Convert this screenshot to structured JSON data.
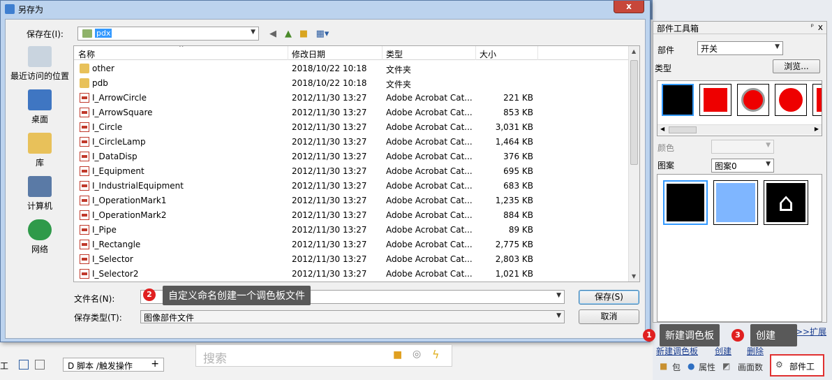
{
  "dialog": {
    "title": "另存为",
    "save_in_label": "保存在(I):",
    "save_in_value": "pdx",
    "places": [
      "最近访问的位置",
      "桌面",
      "库",
      "计算机",
      "网络"
    ],
    "columns": [
      "名称",
      "修改日期",
      "类型",
      "大小"
    ],
    "files": [
      {
        "name": "other",
        "date": "2018/10/22 10:18",
        "type": "文件夹",
        "size": "",
        "kind": "folder"
      },
      {
        "name": "pdb",
        "date": "2018/10/22 10:18",
        "type": "文件夹",
        "size": "",
        "kind": "folder"
      },
      {
        "name": "I_ArrowCircle",
        "date": "2012/11/30 13:27",
        "type": "Adobe Acrobat Cat...",
        "size": "221 KB",
        "kind": "pdf"
      },
      {
        "name": "I_ArrowSquare",
        "date": "2012/11/30 13:27",
        "type": "Adobe Acrobat Cat...",
        "size": "853 KB",
        "kind": "pdf"
      },
      {
        "name": "I_Circle",
        "date": "2012/11/30 13:27",
        "type": "Adobe Acrobat Cat...",
        "size": "3,031 KB",
        "kind": "pdf"
      },
      {
        "name": "I_CircleLamp",
        "date": "2012/11/30 13:27",
        "type": "Adobe Acrobat Cat...",
        "size": "1,464 KB",
        "kind": "pdf"
      },
      {
        "name": "I_DataDisp",
        "date": "2012/11/30 13:27",
        "type": "Adobe Acrobat Cat...",
        "size": "376 KB",
        "kind": "pdf"
      },
      {
        "name": "I_Equipment",
        "date": "2012/11/30 13:27",
        "type": "Adobe Acrobat Cat...",
        "size": "695 KB",
        "kind": "pdf"
      },
      {
        "name": "I_IndustrialEquipment",
        "date": "2012/11/30 13:27",
        "type": "Adobe Acrobat Cat...",
        "size": "683 KB",
        "kind": "pdf"
      },
      {
        "name": "I_OperationMark1",
        "date": "2012/11/30 13:27",
        "type": "Adobe Acrobat Cat...",
        "size": "1,235 KB",
        "kind": "pdf"
      },
      {
        "name": "I_OperationMark2",
        "date": "2012/11/30 13:27",
        "type": "Adobe Acrobat Cat...",
        "size": "884 KB",
        "kind": "pdf"
      },
      {
        "name": "I_Pipe",
        "date": "2012/11/30 13:27",
        "type": "Adobe Acrobat Cat...",
        "size": "89 KB",
        "kind": "pdf"
      },
      {
        "name": "I_Rectangle",
        "date": "2012/11/30 13:27",
        "type": "Adobe Acrobat Cat...",
        "size": "2,775 KB",
        "kind": "pdf"
      },
      {
        "name": "I_Selector",
        "date": "2012/11/30 13:27",
        "type": "Adobe Acrobat Cat...",
        "size": "2,803 KB",
        "kind": "pdf"
      },
      {
        "name": "I_Selector2",
        "date": "2012/11/30 13:27",
        "type": "Adobe Acrobat Cat...",
        "size": "1,021 KB",
        "kind": "pdf"
      }
    ],
    "filename_label": "文件名(N):",
    "filename_value": "",
    "filetype_label": "保存类型(T):",
    "filetype_value": "图像部件文件",
    "save_button": "保存(S)",
    "cancel_button": "取消",
    "close_symbol": "x"
  },
  "annotations": {
    "tip1_badge": "1",
    "tip1_text": "新建调色板",
    "tip2_badge": "2",
    "tip2_text": "自定义命名创建一个调色板文件",
    "tip3_badge": "3",
    "tip3_text": "创建"
  },
  "toolbox": {
    "title": "部件工具箱",
    "pin_symbol": "ᵖ",
    "close_symbol": "x",
    "part_label": "部件",
    "part_value": "开关",
    "type_label": "类型",
    "browse_button": "浏览...",
    "color_label": "颜色",
    "color_value": "",
    "pattern_label": "图案",
    "pattern_value": "图案0",
    "expand_link": ">>扩展",
    "new_palette_link": "新建调色板",
    "create_link": "创建",
    "delete_link": "删除"
  },
  "bottom": {
    "search_placeholder": "搜索",
    "script_tab": "D 脚本 /触发操作",
    "add_symbol": "+",
    "tab_package": "包",
    "tab_properties": "属性",
    "tab_canvas": "画面数",
    "tab_parts": "部件工",
    "left_fragment": "工"
  },
  "colors": {
    "accent_blue": "#3399ff",
    "badge_red": "#e02020",
    "tooltip_bg": "#595959",
    "highlight_border": "#e03030"
  }
}
